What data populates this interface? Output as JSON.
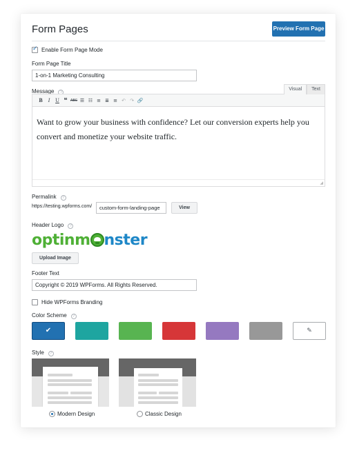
{
  "header": {
    "title": "Form Pages",
    "preview_button": "Preview Form Page"
  },
  "enable_mode": {
    "label": "Enable Form Page Mode",
    "checked": true
  },
  "page_title": {
    "label": "Form Page Title",
    "value": "1-on-1 Marketing Consulting"
  },
  "message": {
    "label": "Message",
    "tabs": [
      "Visual",
      "Text"
    ],
    "toolbar_icons": [
      "bold-icon",
      "italic-icon",
      "underline-icon",
      "blockquote-icon",
      "strikethrough-icon",
      "bullet-list-icon",
      "numbered-list-icon",
      "align-left-icon",
      "align-center-icon",
      "align-right-icon",
      "undo-icon",
      "redo-icon",
      "link-icon"
    ],
    "body": "Want to grow your business with confidence? Let our conversion experts help you convert and monetize your website traffic."
  },
  "permalink": {
    "label": "Permalink",
    "prefix": "https://testing.wpforms.com/",
    "slug": "custom-form-landing-page",
    "view_button": "View"
  },
  "header_logo": {
    "label": "Header Logo",
    "logo_part1": "optinm",
    "logo_part2": "nster",
    "upload_button": "Upload Image"
  },
  "footer_text": {
    "label": "Footer Text",
    "value": "Copyright © 2019 WPForms. All Rights Reserved."
  },
  "hide_branding": {
    "label": "Hide WPForms Branding",
    "checked": false
  },
  "color_scheme": {
    "label": "Color Scheme",
    "swatches": [
      "#2271b1",
      "#1ea5a0",
      "#58b451",
      "#d63638",
      "#9579c0",
      "#989898"
    ],
    "selected_index": 0
  },
  "style": {
    "label": "Style",
    "options": [
      "Modern Design",
      "Classic Design"
    ],
    "selected": "Modern Design"
  }
}
